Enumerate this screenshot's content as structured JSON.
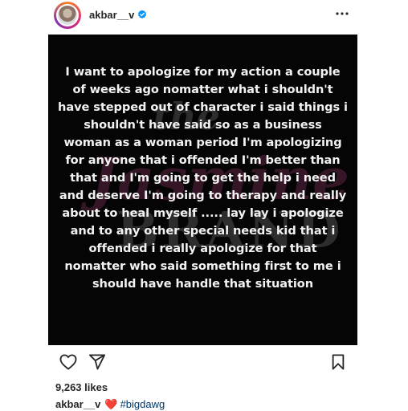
{
  "header": {
    "username": "akbar__v",
    "verified": true,
    "more_icon": "more-horizontal-icon"
  },
  "post": {
    "text": "I want to apologize for my action a couple\nof weeks ago nomatter what i shouldn't\nhave stepped out of character i said things i\nshouldn't have said so as a business\nwoman as a woman period I'm apologizing\nfor anyone that i offended I'm better than\nthat and I'm going to get the help i need\nand deserve I'm going to therapy and really\nabout to heal myself ..... lay lay i apologize\nand to any other special needs kid that i\noffended i really apologize for that\nnomatter who said something first to me i\nshould have handle that situation",
    "background_color": "#050505",
    "text_color": "#f2f2f2",
    "watermark": "the Jasmine BRAND"
  },
  "actions": {
    "like_icon": "heart-outline-icon",
    "share_icon": "paper-plane-icon",
    "save_icon": "bookmark-icon"
  },
  "likes": "9,263 likes",
  "caption": {
    "username": "akbar__v",
    "emoji": "❤️",
    "hashtag": "#bigdawg"
  },
  "colors": {
    "hashtag": "#00376b",
    "verified_badge": "#0095f6",
    "heart": "#ed1c24"
  }
}
